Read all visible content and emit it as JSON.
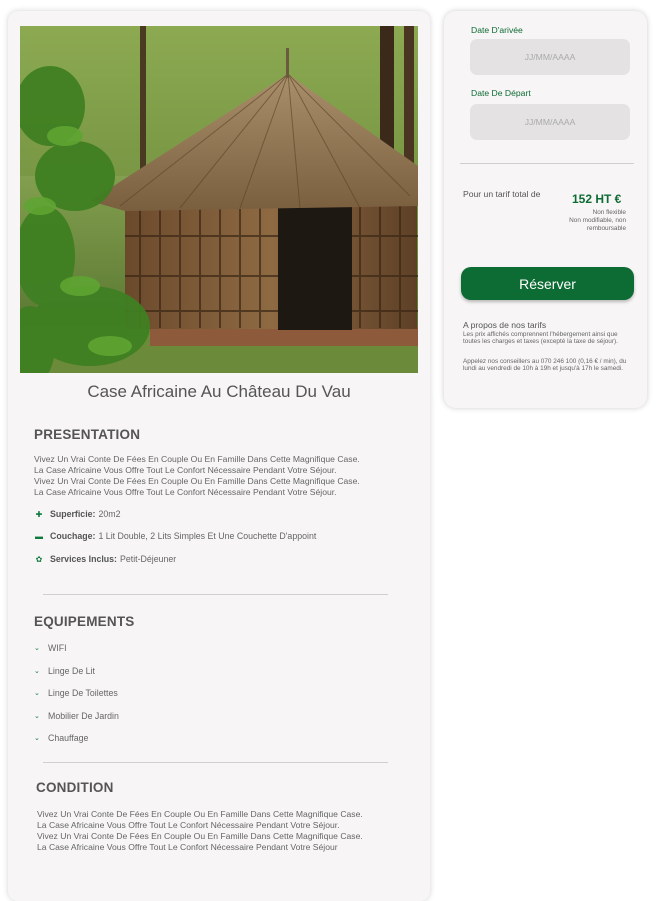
{
  "room": {
    "title": "Case Africaine Au Château Du Vau"
  },
  "presentation": {
    "heading": "PRESENTATION",
    "lines": [
      "Vivez Un Vrai Conte De Fées En Couple Ou En Famille Dans Cette Magnifique Case.",
      "La Case Africaine Vous Offre Tout Le Confort Nécessaire Pendant Votre Séjour.",
      "Vivez Un Vrai Conte De Fées En Couple Ou En Famille Dans Cette Magnifique Case.",
      "La Case Africaine Vous Offre Tout Le Confort Nécessaire Pendant Votre Séjour."
    ],
    "features": [
      {
        "icon": "area-icon",
        "label": "Superficie:",
        "value": "20m2"
      },
      {
        "icon": "bed-icon",
        "label": "Couchage:",
        "value": "1 Lit Double, 2 Lits Simples Et Une Couchette D'appoint"
      },
      {
        "icon": "paw-icon",
        "label": "Services Inclus:",
        "value": "Petit-Déjeuner"
      }
    ]
  },
  "equipements": {
    "heading": "EQUIPEMENTS",
    "items": [
      "WIFI",
      "Linge De Lit",
      "Linge  De Toilettes",
      "Mobilier De Jardin",
      "Chauffage"
    ]
  },
  "condition": {
    "heading": "CONDITION",
    "lines": [
      "Vivez Un Vrai Conte De Fées En Couple Ou En Famille Dans Cette Magnifique Case.",
      "La Case Africaine Vous Offre Tout Le Confort Nécessaire Pendant Votre Séjour.",
      "Vivez Un Vrai Conte De Fées En Couple Ou En Famille Dans Cette Magnifique Case.",
      "La Case Africaine Vous Offre Tout Le Confort Nécessaire Pendant Votre Séjour"
    ]
  },
  "booking": {
    "arrival_label": "Date D'arivée",
    "arrival_placeholder": "JJ/MM/AAAA",
    "departure_label": "Date De Départ",
    "departure_placeholder": "JJ/MM/AAAA",
    "total_label": "Pour un tarif total de",
    "price": "152 HT €",
    "non_flexible": "Non flexible",
    "non_modifiable": "Non modifiable, non remboursable",
    "reserve_label": "Réserver",
    "about_title": "A propos de nos tarifs",
    "about_text": "Les prix affichés comprennent l'hébergement ainsi que toutes les charges et taxes (excepté la taxe de séjour).",
    "contact_text": "Appelez nos conseillers au 070 246 100 (0,16 € / min), du lundi au vendredi de 10h à 19h et jusqu'à 17h le samedi."
  },
  "colors": {
    "accent": "#0d6b34",
    "input_bg": "#e4e2e2",
    "card_bg": "#f7f5f5"
  }
}
